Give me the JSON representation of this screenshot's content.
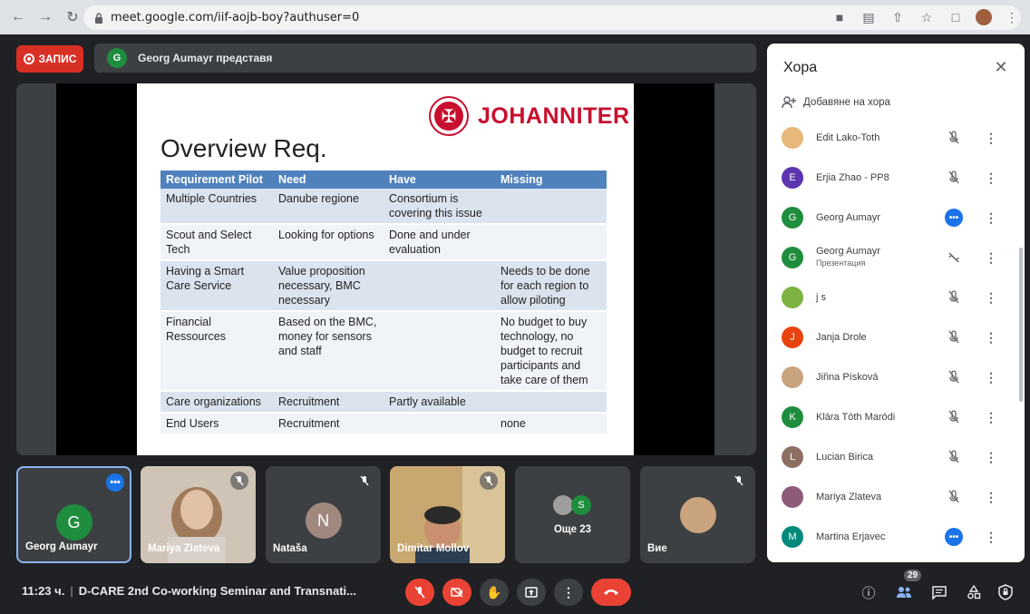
{
  "browser": {
    "url": "meet.google.com/iif-aojb-boy?authuser=0"
  },
  "meeting": {
    "record_label": "ЗАПИС",
    "presenter_initial": "G",
    "presenter_text": "Georg Aumayr представя"
  },
  "slide": {
    "logo_text": "JOHANNITER",
    "title": "Overview Req.",
    "headers": [
      "Requirement Pilot",
      "Need",
      "Have",
      "Missing"
    ],
    "rows": [
      [
        "Multiple Countries",
        "Danube regione",
        "Consortium is covering this issue",
        ""
      ],
      [
        "Scout and Select Tech",
        "Looking for options",
        "Done and under evaluation",
        ""
      ],
      [
        "Having a Smart Care Service",
        "Value proposition necessary, BMC necessary",
        "",
        "Needs to be done for each region to allow piloting"
      ],
      [
        "Financial Ressources",
        "Based on the BMC, money for sensors and staff",
        "",
        "No budget to buy technology, no budget to recruit participants and take care of them"
      ],
      [
        "Care organizations",
        "Recruitment",
        "Partly available",
        ""
      ],
      [
        "End Users",
        "Recruitment",
        "",
        "none"
      ]
    ]
  },
  "tiles": [
    {
      "name": "Georg Aumayr",
      "initial": "G",
      "color": "#1e8e3e"
    },
    {
      "name": "Mariya Zlateva"
    },
    {
      "name": "Nataša",
      "initial": "N",
      "color": "#a1887f"
    },
    {
      "name": "Dimitar Mollov"
    },
    {
      "name": "Още 23",
      "initial": "S",
      "color": "#1e8e3e"
    },
    {
      "name": "Вие"
    }
  ],
  "bottom": {
    "time": "11:23 ч.",
    "separator": "|",
    "meeting_title": "D-CARE 2nd Co-working Seminar and Transnati...",
    "participant_count": "29"
  },
  "panel": {
    "title": "Хора",
    "add_people": "Добавяне на хора",
    "people": [
      {
        "name": "Edit Lako-Toth",
        "sub": "",
        "initial": "",
        "color": "#e8b77a",
        "mic": "muted"
      },
      {
        "name": "Erjia Zhao - PP8",
        "sub": "",
        "initial": "E",
        "color": "#5e35b1",
        "mic": "muted"
      },
      {
        "name": "Georg Aumayr",
        "sub": "",
        "initial": "G",
        "color": "#1e8e3e",
        "mic": "active"
      },
      {
        "name": "Georg Aumayr",
        "sub": "Презентация",
        "initial": "G",
        "color": "#1e8e3e",
        "mic": "presenting"
      },
      {
        "name": "j s",
        "sub": "",
        "initial": "",
        "color": "#7cb342",
        "mic": "muted"
      },
      {
        "name": "Janja Drole",
        "sub": "",
        "initial": "J",
        "color": "#e8430f",
        "mic": "muted"
      },
      {
        "name": "Jiřina Písková",
        "sub": "",
        "initial": "",
        "color": "#c9a27e",
        "mic": "muted"
      },
      {
        "name": "Klára Tóth Maródi",
        "sub": "",
        "initial": "K",
        "color": "#1e8e3e",
        "mic": "muted"
      },
      {
        "name": "Lucian Birica",
        "sub": "",
        "initial": "L",
        "color": "#8d6e63",
        "mic": "muted"
      },
      {
        "name": "Mariya Zlateva",
        "sub": "",
        "initial": "",
        "color": "#8e5a7a",
        "mic": "muted"
      },
      {
        "name": "Martina Erjavec",
        "sub": "",
        "initial": "M",
        "color": "#00897b",
        "mic": "active"
      }
    ]
  }
}
